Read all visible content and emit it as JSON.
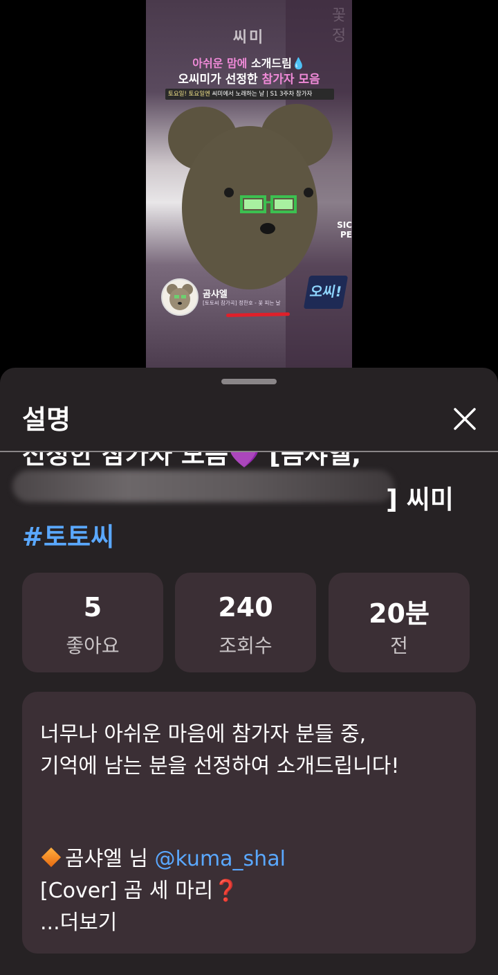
{
  "video": {
    "logo": "씨미",
    "corner_text": "꽃 정",
    "headline_line1_pink": "아쉬운 맘에",
    "headline_line1_rest": " 소개드림💧",
    "headline_line2_rest": "오씨미가 선정한 ",
    "headline_line2_pink": "참가자 모음",
    "tag_yellow": "토요일! 토요일엔",
    "tag_mid": " 씨미에서 노래하는 날",
    "tag_sep": " | ",
    "tag_end": "S1 3주차 참가자",
    "badge": "오씨!",
    "creator_name": "곰샤엘",
    "creator_sub": "[토토씨 참가곡] 정한호 - 꽃 피는 날",
    "side_text_1": "SIC",
    "side_text_2": "PE"
  },
  "sheet": {
    "title": "설명",
    "close_icon": "close-icon",
    "title_line1": "선정한 참가자 모음💜 [곰샤엘,",
    "title_line2_end": "] 씨미",
    "hashtag": "#토토씨",
    "stats": [
      {
        "num": "5",
        "label": "좋아요"
      },
      {
        "num": "240",
        "label": "조회수"
      },
      {
        "num": "20분",
        "label": "전"
      }
    ],
    "description": {
      "line1": "너무나 아쉬운 마음에 참가자 분들 중,",
      "line2": "기억에 남는 분을 선정하여 소개드립니다!",
      "item_name": "곰샤엘 님 ",
      "item_mention": "@kuma_shal",
      "item_song": "[Cover] 곰 세 마리",
      "item_song_mark": "❓",
      "more": "...더보기"
    }
  }
}
